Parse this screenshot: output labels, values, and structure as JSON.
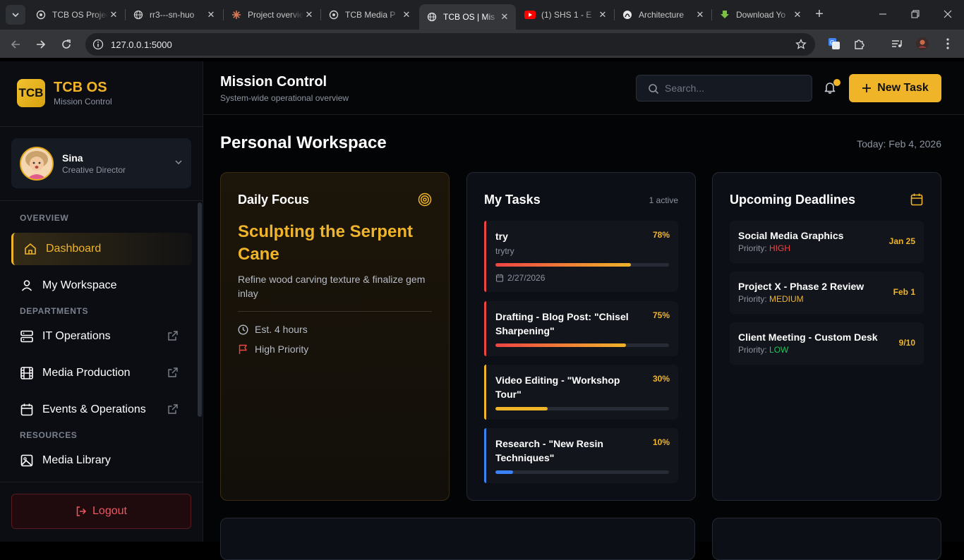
{
  "browser": {
    "tabs": [
      {
        "title": "TCB OS Project",
        "icon": "chatgpt-icon",
        "active": false
      },
      {
        "title": "rr3---sn-huo",
        "icon": "globe-icon",
        "active": false
      },
      {
        "title": "Project overvie",
        "icon": "claude-icon",
        "active": false
      },
      {
        "title": "TCB Media P",
        "icon": "chatgpt-icon",
        "active": false
      },
      {
        "title": "TCB OS | Mis",
        "icon": "globe-icon",
        "active": true
      },
      {
        "title": "(1) SHS 1 - E",
        "icon": "youtube-icon",
        "active": false
      },
      {
        "title": "Architecture",
        "icon": "logo-icon",
        "active": false
      },
      {
        "title": "Download Yo",
        "icon": "download-icon",
        "active": false
      }
    ],
    "url": "127.0.0.1:5000"
  },
  "sidebar": {
    "logo_text": "TCB",
    "brand_name": "TCB OS",
    "brand_sub": "Mission Control",
    "profile": {
      "name": "Sina",
      "role": "Creative Director"
    },
    "sections": {
      "overview": "OVERVIEW",
      "departments": "DEPARTMENTS",
      "resources": "RESOURCES"
    },
    "items": [
      {
        "label": "Dashboard",
        "icon": "home-icon"
      },
      {
        "label": "My Workspace",
        "icon": "user-icon"
      },
      {
        "label": "IT Operations",
        "icon": "server-icon"
      },
      {
        "label": "Media Production",
        "icon": "film-icon"
      },
      {
        "label": "Events & Operations",
        "icon": "calendar-icon"
      },
      {
        "label": "Media Library",
        "icon": "image-icon"
      }
    ],
    "logout_label": "Logout"
  },
  "header": {
    "title": "Mission Control",
    "subtitle": "System-wide operational overview",
    "search_placeholder": "Search...",
    "new_task_label": "New Task"
  },
  "workspace": {
    "title": "Personal Workspace",
    "date": "Today: Feb 4, 2026"
  },
  "daily_focus": {
    "title": "Daily Focus",
    "headline": "Sculpting the Serpent Cane",
    "description": "Refine wood carving texture & finalize gem inlay",
    "estimate": "Est. 4 hours",
    "priority": "High Priority"
  },
  "my_tasks": {
    "title": "My Tasks",
    "active_count": "1 active",
    "items": [
      {
        "name": "try",
        "note": "trytry",
        "percent": "78%",
        "progress": 0.78,
        "date": "2/27/2026",
        "accent": "#ef4444",
        "fill": "linear-gradient(90deg,#ef4444,#f0b429)"
      },
      {
        "name": "Drafting - Blog Post: \"Chisel Sharpening\"",
        "percent": "75%",
        "progress": 0.75,
        "accent": "#ef4444",
        "fill": "linear-gradient(90deg,#ef4444,#f0b429)"
      },
      {
        "name": "Video Editing - \"Workshop Tour\"",
        "percent": "30%",
        "progress": 0.3,
        "accent": "#f0b429",
        "fill": "#f0b429"
      },
      {
        "name": "Research - \"New Resin Techniques\"",
        "percent": "10%",
        "progress": 0.1,
        "accent": "#3b82f6",
        "fill": "#3b82f6"
      }
    ]
  },
  "deadlines": {
    "title": "Upcoming Deadlines",
    "priority_label": "Priority:",
    "items": [
      {
        "name": "Social Media Graphics",
        "priority": "HIGH",
        "color": "#ef4444",
        "date": "Jan 25"
      },
      {
        "name": "Project X - Phase 2 Review",
        "priority": "MEDIUM",
        "color": "#f0b429",
        "date": "Feb 1"
      },
      {
        "name": "Client Meeting - Custom Desk",
        "priority": "LOW",
        "color": "#22c55e",
        "date": "9/10"
      }
    ]
  }
}
